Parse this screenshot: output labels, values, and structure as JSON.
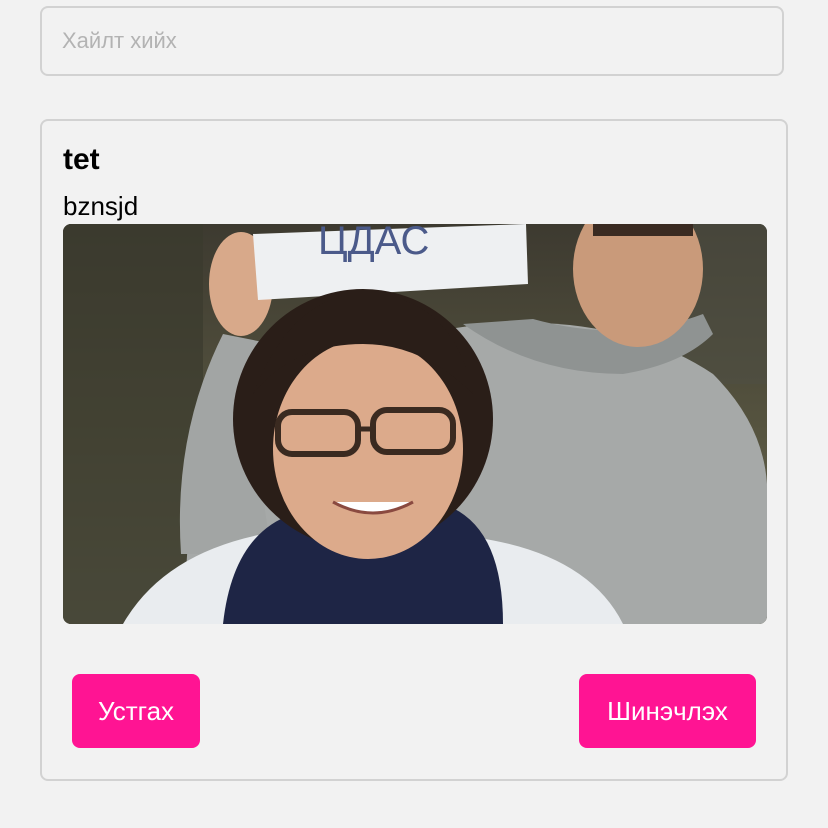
{
  "search": {
    "placeholder": "Хайлт хийх",
    "value": ""
  },
  "post": {
    "title": "tet",
    "body": "bznsjd",
    "image_icon": "photo-of-two-people-holding-sign",
    "sign_text": "ЦДАС"
  },
  "actions": {
    "delete_label": "Устгах",
    "update_label": "Шинэчлэх"
  },
  "colors": {
    "background": "#f2f2f2",
    "border": "#d2d2d2",
    "accent": "#ff1493"
  }
}
